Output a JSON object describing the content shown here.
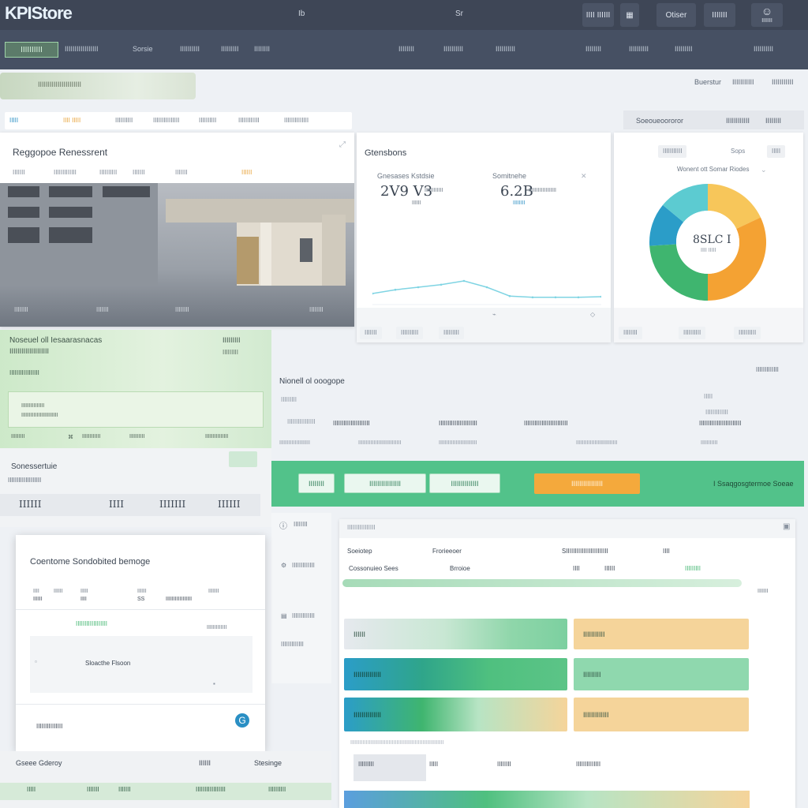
{
  "app": {
    "title": "KPIStore"
  },
  "topbar": {
    "mid_a": "Ib",
    "mid_b": "Sr",
    "btn1": "IIII IIIIII",
    "btn2": "Otiser",
    "btn3": "IIIIIII",
    "user_label": "IIIIIII"
  },
  "nav": {
    "chip": "IIIIIIIIII",
    "items": [
      "IIIIIIIIIIIIIIIII",
      "Sorsie",
      "IIIIIIIIII",
      "IIIIIIIII",
      "IIIIIIII",
      "IIIIIIII",
      "IIIIIIIIII",
      "IIIIIIIIII",
      "IIIIIIII",
      "IIIIIIIIII",
      "IIIIIIIII",
      "IIIIIIIIII"
    ]
  },
  "search": {
    "placeholder": "IIIIIIIIIIIIIIIIIIIIII"
  },
  "header_links": [
    "Buerstur",
    "IIIIIIIIIII",
    "IIIIIIIIIII"
  ],
  "filters": [
    "IIIII",
    "IIII IIIII",
    "IIIIIIIIII",
    "IIIIIIIIIIIIIII",
    "IIIIIIIIII",
    "IIIIIIIIIIII",
    "IIIIIIIIIIIIII"
  ],
  "panel_header": {
    "left": "Soeoueoororor",
    "right": "IIIIIIIIIIII",
    "extra": "IIIIIIII"
  },
  "photo_card": {
    "title": "Reggopoe Renessrent",
    "tabs": [
      "IIIIIII",
      "IIIIIIIIIIIII",
      "IIIIIIIIII",
      "IIIIIII",
      "IIIIIII",
      "IIIIII"
    ],
    "footer": [
      "IIIIIIII",
      "IIIIIII",
      "IIIIIIII",
      "IIIIIIII"
    ]
  },
  "stats_card": {
    "title": "Gtensbons",
    "left_label": "Gnesases Kstdsie",
    "left_value": "2V9 V3",
    "left_sub": "IIIIIIIIIIII",
    "left_foot": "IIIIII",
    "right_label": "Somitnehe",
    "right_value": "6.2B",
    "right_sub": "IIIIIIIIIIIIIIIIII",
    "right_foot": "IIIIIIII",
    "chips": [
      "IIIIIII",
      "IIIIIIIIII",
      "IIIIIIIII"
    ]
  },
  "chart_data": {
    "type": "line",
    "x": [
      0,
      1,
      2,
      3,
      4,
      5,
      6,
      7,
      8,
      9,
      10
    ],
    "series": [
      {
        "values": [
          2.0,
          2.6,
          3.0,
          3.4,
          4.0,
          3.0,
          1.6,
          1.4,
          1.4,
          1.4,
          1.5
        ]
      }
    ],
    "ylim": [
      0,
      10
    ]
  },
  "donut": {
    "tabs": [
      "IIIIIIIIIII",
      "Sops",
      "IIIII"
    ],
    "subtitle": "Wonent ott Somar Riodes",
    "center_value": "8SLC I",
    "center_sub": "IIII IIIII",
    "segments": [
      {
        "value": 18,
        "color": "#f7c65a"
      },
      {
        "value": 32,
        "color": "#f4a233"
      },
      {
        "value": 24,
        "color": "#3fb56f"
      },
      {
        "value": 12,
        "color": "#2b9dc8"
      },
      {
        "value": 14,
        "color": "#5ccbd1"
      }
    ],
    "chips": [
      "IIIIIIII",
      "IIIIIIIIII",
      "IIIIIIIIII"
    ]
  },
  "left_green": {
    "title": "Noseuel oll Iesaarasnacas",
    "subtitle": "IIIIIIIIIIIIIIIIIIII",
    "right_label": "IIIIIIIII",
    "right_sub": "IIIIIIIII",
    "row_label": "IIIIIIIIIIIIIIIII",
    "inner_line1": "IIIIIIIIIIIIIII",
    "inner_line2": "IIIIIIIIIIIIIIIIIIIIIIII",
    "foot": [
      "IIIIIIIII",
      "IIIIIIIIIIII",
      "IIIIIIIIII",
      "IIIIIIIIIIIIIII"
    ]
  },
  "sec_left": {
    "title": "Sonessertuie",
    "sub": "IIIIIIIIIIIIIIIIIII",
    "values": [
      "IIIIII",
      "IIII",
      "IIIIIII",
      "IIIIII"
    ]
  },
  "summary": {
    "title": "Nionell ol ooogope",
    "right": "IIIIIIIIIIIII",
    "row1": [
      "IIIIIIIII",
      "IIIIIIIIIIIIIIII",
      "IIIIIIIIIIIIIIIIIIIII",
      "IIIIIIIIIIIIIIIIIIIIII",
      "IIIIIIIIIIIIIIIIIIIIIIIII",
      "IIIIIIIIIIIIIIIIIIIIIIII"
    ],
    "row2": [
      "IIIIIIIIIIIIIIIIIIII",
      "IIIIIIIIIIIIIIIIIIIIIIIIIIII",
      "IIIIIIIIIIIIIIIIIIIIIIIII",
      "IIIIIIIIIIIIIIIIIIIIIIIIIII",
      "IIIIIIIIIII"
    ],
    "side": [
      "IIIII",
      "IIIIIIIIIIIII"
    ]
  },
  "green_band": {
    "f1": "IIIIIIII",
    "f2": "IIIIIIIIIIIIIIII",
    "f3": "IIIIIIIIIIIIII",
    "cta": "IIIIIIIIIIIIIIII",
    "right": "I Ssaqgosgtermoe Soeae"
  },
  "modal": {
    "title": "Coentome Sondobited bemoge",
    "cols": [
      "IIII",
      "IIIIII",
      "IIIII",
      "IIIIII",
      "IIIIIII"
    ],
    "values": [
      "IIIIII",
      "IIII",
      "SS",
      "IIIIIIIIIIIIIIIII"
    ],
    "sub_left": "IIIIIIIIIIIIIIIIII",
    "sub_right": "IIIIIIIIIIIII",
    "chart_label": "Sloacthe Flsoon",
    "footer": "IIIIIIIIIIIIIII",
    "action": "G"
  },
  "bottom_left": {
    "title": "Gseee Gderoy",
    "mid": "IIIIII",
    "right": "Stesinge",
    "chips": [
      "IIIII",
      "IIIIIII",
      "IIIIIII",
      "IIIIIIIIIIIIIIIII",
      "IIIIIIIIII"
    ]
  },
  "side_menu": {
    "items": [
      "IIIIIIII",
      "IIIIIIIIIIIII",
      "IIIIIIIIIIIII",
      "IIIIIIIIIIIII"
    ]
  },
  "detail": {
    "title": "IIIIIIIIIIIIIIII",
    "headers": [
      "Soeiotep",
      "Frorieeoer",
      "SIIIIIIIIIIIIIIIIIIIIIIII",
      "IIII"
    ],
    "row": [
      "Cossonuieo Sees",
      "Brroioe",
      "IIII",
      "IIIIII",
      "IIIIIIIII"
    ],
    "side_val": "IIIIIII",
    "blocks": [
      "IIIIII",
      "IIIIIIIIIII",
      "IIIIIIIIIIIIII",
      "IIIIIIIII",
      "IIIIIIIIIIIIII",
      "IIIIIIIIIIIII"
    ],
    "caption": "IIIIIIIIIIIIIIIIIIIIIIIIIIIIIIIIIIIIIIIIIIIIIIIIIIIIIIIIIIIII",
    "foot": [
      "IIIIIIIII",
      "IIIII",
      "IIIIIIII",
      "IIIIIIIIIIIIII"
    ]
  }
}
